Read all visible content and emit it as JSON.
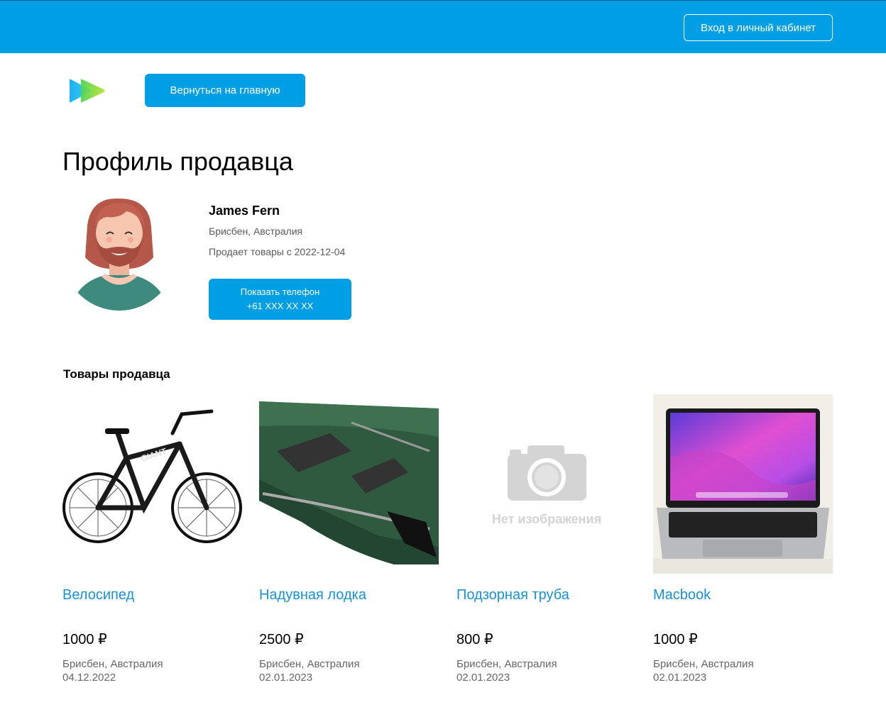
{
  "header": {
    "login_label": "Вход в личный кабинет"
  },
  "nav": {
    "home_label": "Вернуться на главную"
  },
  "page": {
    "title": "Профиль продавца"
  },
  "seller": {
    "name": "James Fern",
    "location": "Брисбен, Австралия",
    "since": "Продает товары с 2022-12-04",
    "phone_button": {
      "line1": "Показать телефон",
      "line2": "+61 XXX XX XX"
    }
  },
  "products_section": {
    "title": "Товары продавца"
  },
  "products": [
    {
      "title": "Велосипед",
      "price": "1000 ₽",
      "location": "Брисбен, Австралия",
      "date": "04.12.2022",
      "image": "bicycle"
    },
    {
      "title": "Надувная лодка",
      "price": "2500 ₽",
      "location": "Брисбен, Австралия",
      "date": "02.01.2023",
      "image": "inflatable-boat"
    },
    {
      "title": "Подзорная труба",
      "price": "800 ₽",
      "location": "Брисбен, Австралия",
      "date": "02.01.2023",
      "image": "no-image",
      "no_image_label": "Нет изображения"
    },
    {
      "title": "Macbook",
      "price": "1000 ₽",
      "location": "Брисбен, Австралия",
      "date": "02.01.2023",
      "image": "laptop"
    }
  ],
  "colors": {
    "brand": "#009ee4",
    "link": "#1a91d6",
    "muted": "#666666"
  }
}
